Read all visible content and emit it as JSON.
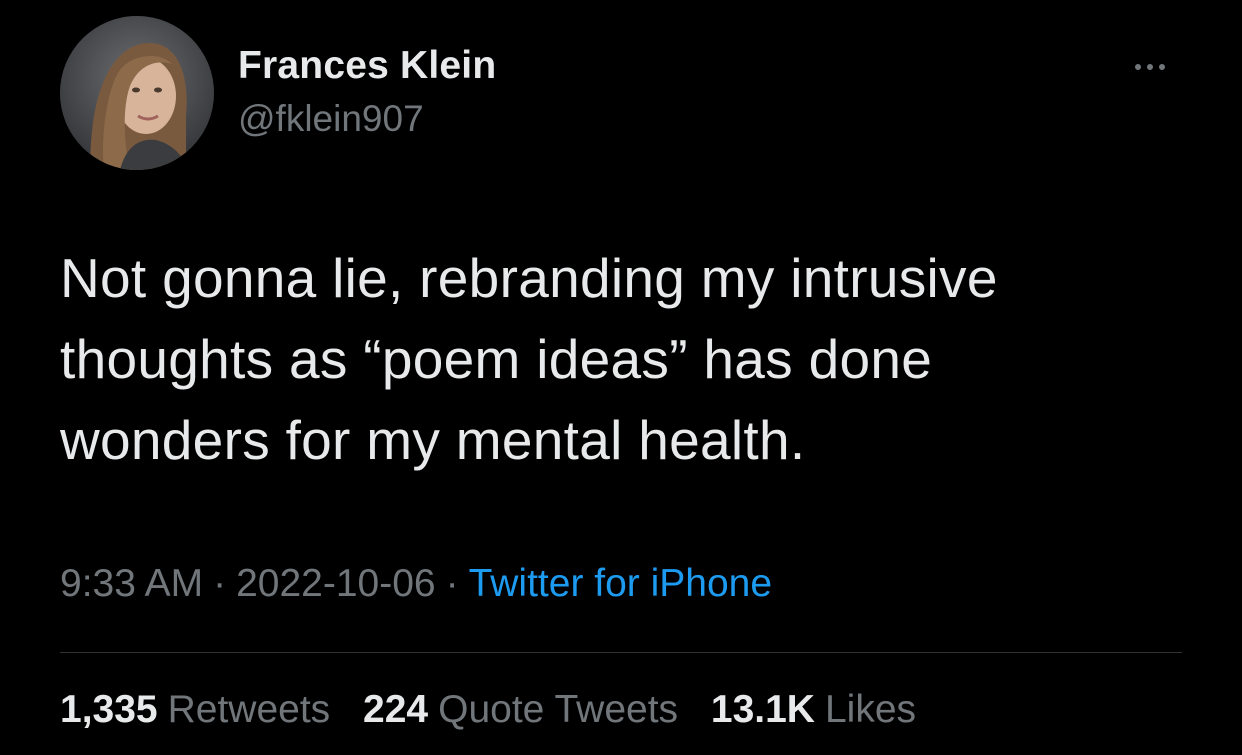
{
  "author": {
    "display_name": "Frances Klein",
    "handle": "@fklein907",
    "avatar_icon": "profile-photo"
  },
  "more_icon": "more-horizontal-icon",
  "tweet": {
    "lines": [
      "Not gonna lie, rebranding my intrusive",
      "thoughts as “poem ideas” has done",
      "wonders for my mental health."
    ]
  },
  "meta": {
    "time": "9:33 AM",
    "separator": "·",
    "date": "2022-10-06",
    "source": "Twitter for iPhone"
  },
  "stats": {
    "retweets_count": "1,335",
    "retweets_label": "Retweets",
    "quotes_count": "224",
    "quotes_label": "Quote Tweets",
    "likes_count": "13.1K",
    "likes_label": "Likes"
  },
  "colors": {
    "background": "#000000",
    "primary_text": "#e7e9ea",
    "secondary_text": "#71767b",
    "link": "#1d9bf0",
    "divider": "#2f3336"
  }
}
